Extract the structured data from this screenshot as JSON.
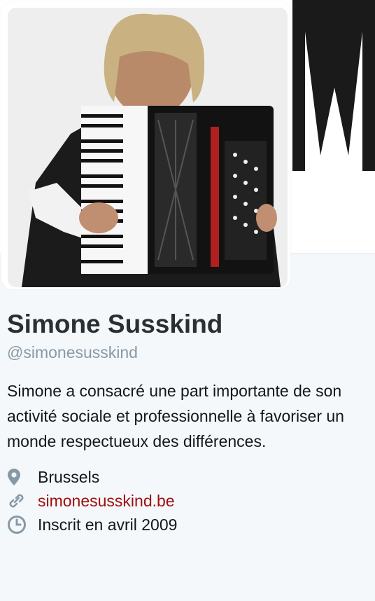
{
  "profile": {
    "name": "Simone Susskind",
    "handle": "@simonesusskind",
    "bio": "Simone a consacré une part importante de son activité sociale et professionnelle à favoriser un monde respectueux des différences.",
    "location": "Brussels",
    "website": "simonesusskind.be",
    "joined": "Inscrit en avril 2009"
  },
  "icons": {
    "location": "map-pin-icon",
    "website": "link-icon",
    "joined": "clock-icon"
  },
  "colors": {
    "link": "#a10d0d",
    "secondary_text": "#8899a6",
    "icon": "#8899a6",
    "background": "#f5f8fa"
  }
}
